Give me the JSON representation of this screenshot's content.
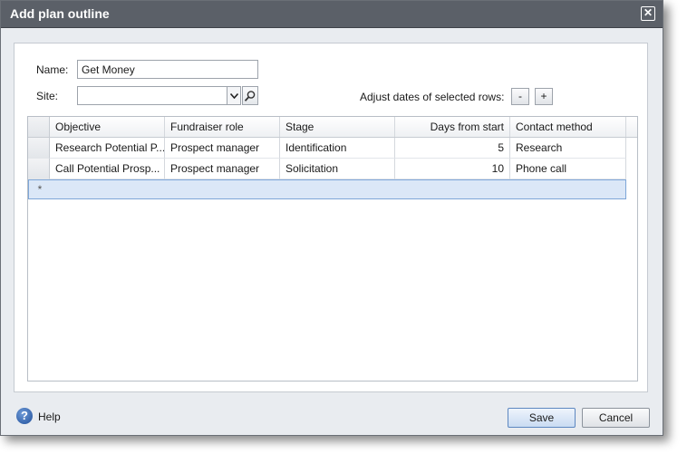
{
  "dialog": {
    "title": "Add plan outline",
    "close_symbol": "✕"
  },
  "form": {
    "name_label": "Name:",
    "name_value": "Get Money",
    "site_label": "Site:",
    "site_value": "",
    "adjust_label": "Adjust dates of selected rows:",
    "minus_label": "-",
    "plus_label": "+"
  },
  "grid": {
    "columns": [
      "Objective",
      "Fundraiser role",
      "Stage",
      "Days from start",
      "Contact method"
    ],
    "rows": [
      {
        "objective": "Research Potential P...",
        "role": "Prospect manager",
        "stage": "Identification",
        "days": "5",
        "method": "Research"
      },
      {
        "objective": "Call Potential Prosp...",
        "role": "Prospect manager",
        "stage": "Solicitation",
        "days": "10",
        "method": "Phone call"
      }
    ],
    "new_row_marker": "*"
  },
  "footer": {
    "help_label": "Help",
    "help_icon_glyph": "?",
    "save_label": "Save",
    "cancel_label": "Cancel"
  },
  "icons": {
    "dropdown": "chevron-down-icon",
    "search": "magnifier-icon",
    "help": "help-circle-icon",
    "close": "close-icon"
  }
}
